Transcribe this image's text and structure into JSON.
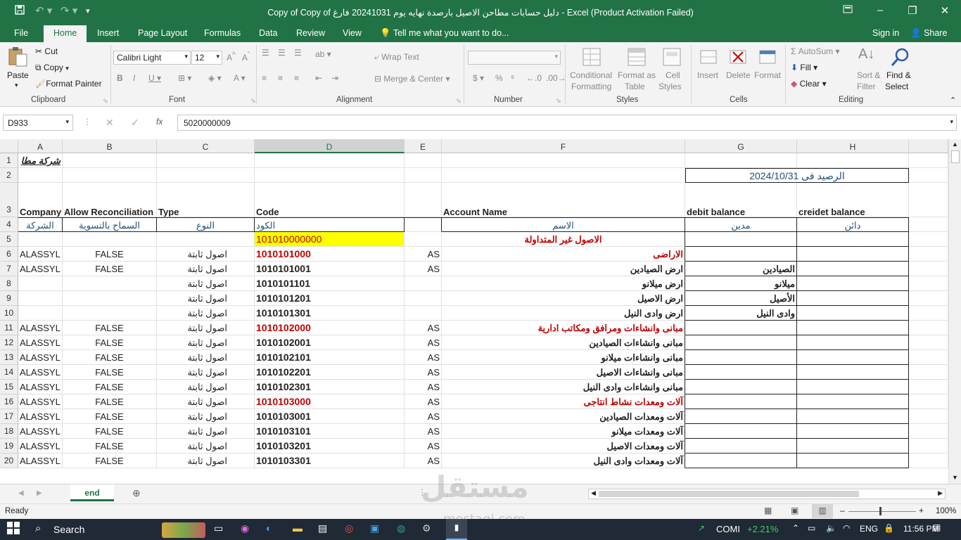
{
  "title_bar": {
    "title": "Copy of Copy of دليل حسابات مطاحن الاصيل بارصدة نهايه يوم 20241031 فارغ - Excel (Product Activation Failed)"
  },
  "menu": {
    "tabs": [
      "File",
      "Home",
      "Insert",
      "Page Layout",
      "Formulas",
      "Data",
      "Review",
      "View"
    ],
    "tell_me": "Tell me what you want to do...",
    "sign_in": "Sign in",
    "share": "Share"
  },
  "ribbon": {
    "clipboard": {
      "paste": "Paste",
      "cut": "Cut",
      "copy": "Copy",
      "format_painter": "Format Painter",
      "label": "Clipboard"
    },
    "font": {
      "name": "Calibri Light",
      "size": "12",
      "label": "Font"
    },
    "alignment": {
      "wrap": "Wrap Text",
      "merge": "Merge & Center",
      "label": "Alignment"
    },
    "number": {
      "label": "Number"
    },
    "styles": {
      "conditional": "Conditional",
      "conditional2": "Formatting",
      "format_as": "Format as",
      "format_as2": "Table",
      "cell": "Cell",
      "cell2": "Styles",
      "label": "Styles"
    },
    "cells": {
      "insert": "Insert",
      "delete": "Delete",
      "format": "Format",
      "label": "Cells"
    },
    "editing": {
      "autosum": "AutoSum",
      "fill": "Fill",
      "clear": "Clear",
      "sort": "Sort &",
      "sort2": "Filter",
      "find": "Find &",
      "find2": "Select",
      "label": "Editing"
    }
  },
  "formula_bar": {
    "name_box": "D933",
    "fx": "fx",
    "value": "5020000009"
  },
  "columns": [
    "A",
    "B",
    "C",
    "D",
    "E",
    "F",
    "G",
    "H"
  ],
  "rows": [
    {
      "n": "1",
      "A": "شركة مطا",
      "B": "",
      "C": "",
      "D": "",
      "E": "",
      "F": "",
      "G": "",
      "H": ""
    },
    {
      "n": "2",
      "A": "",
      "B": "",
      "C": "",
      "D": "",
      "E": "",
      "F": "",
      "G": "الرصيد فى 2024/10/31",
      "H": ""
    },
    {
      "n": "3",
      "A": "Company",
      "B": "Allow Reconciliation",
      "C": "Type",
      "D": "Code",
      "E": "",
      "F": "Account Name",
      "G": "debit balance",
      "H": "creidet balance"
    },
    {
      "n": "4",
      "A": "الشركة",
      "B": "السماح بالتسوية",
      "C": "النوع",
      "D": "الكود",
      "E": "",
      "F": "الاسم",
      "G": "مدين",
      "H": "دائن"
    },
    {
      "n": "5",
      "A": "",
      "B": "",
      "C": "",
      "D": "101010000000",
      "E": "",
      "F": "الاصول غير المتداولة",
      "G": "",
      "H": ""
    },
    {
      "n": "6",
      "A": "ALASSYL",
      "B": "FALSE",
      "C": "اصول ثابتة",
      "D": "1010101000",
      "E": "AS",
      "F": "الاراضى",
      "G": "",
      "H": ""
    },
    {
      "n": "7",
      "A": "ALASSYL",
      "B": "FALSE",
      "C": "اصول ثابتة",
      "D": "1010101001",
      "E": "AS",
      "F": "ارض الصيادين",
      "G": "الصيادين",
      "H": ""
    },
    {
      "n": "8",
      "A": "",
      "B": "",
      "C": "اصول ثابتة",
      "D": "1010101101",
      "E": "",
      "F": "ارض ميلانو",
      "G": "ميلانو",
      "H": ""
    },
    {
      "n": "9",
      "A": "",
      "B": "",
      "C": "اصول ثابتة",
      "D": "1010101201",
      "E": "",
      "F": "ارض الاصيل",
      "G": "الأصيل",
      "H": ""
    },
    {
      "n": "10",
      "A": "",
      "B": "",
      "C": "اصول ثابتة",
      "D": "1010101301",
      "E": "",
      "F": "ارض وادى النيل",
      "G": "وادى النيل",
      "H": ""
    },
    {
      "n": "11",
      "A": "ALASSYL",
      "B": "FALSE",
      "C": "اصول ثابتة",
      "D": "1010102000",
      "E": "AS",
      "F": "مبانى وانشاءات ومرافق ومكاتب ادارية",
      "G": "",
      "H": ""
    },
    {
      "n": "12",
      "A": "ALASSYL",
      "B": "FALSE",
      "C": "اصول ثابتة",
      "D": "1010102001",
      "E": "AS",
      "F": "مبانى وانشاءات الصيادين",
      "G": "",
      "H": ""
    },
    {
      "n": "13",
      "A": "ALASSYL",
      "B": "FALSE",
      "C": "اصول ثابتة",
      "D": "1010102101",
      "E": "AS",
      "F": "مبانى وانشاءات ميلانو",
      "G": "",
      "H": ""
    },
    {
      "n": "14",
      "A": "ALASSYL",
      "B": "FALSE",
      "C": "اصول ثابتة",
      "D": "1010102201",
      "E": "AS",
      "F": "مبانى وانشاءات الاصيل",
      "G": "",
      "H": ""
    },
    {
      "n": "15",
      "A": "ALASSYL",
      "B": "FALSE",
      "C": "اصول ثابتة",
      "D": "1010102301",
      "E": "AS",
      "F": "مبانى وانشاءات وادى النيل",
      "G": "",
      "H": ""
    },
    {
      "n": "16",
      "A": "ALASSYL",
      "B": "FALSE",
      "C": "اصول ثابتة",
      "D": "1010103000",
      "E": "AS",
      "F": "آلات ومعدات نشاط انتاجى",
      "G": "",
      "H": ""
    },
    {
      "n": "17",
      "A": "ALASSYL",
      "B": "FALSE",
      "C": "اصول ثابتة",
      "D": "1010103001",
      "E": "AS",
      "F": "آلات ومعدات الصيادين",
      "G": "",
      "H": ""
    },
    {
      "n": "18",
      "A": "ALASSYL",
      "B": "FALSE",
      "C": "اصول ثابتة",
      "D": "1010103101",
      "E": "AS",
      "F": "آلات ومعدات ميلانو",
      "G": "",
      "H": ""
    },
    {
      "n": "19",
      "A": "ALASSYL",
      "B": "FALSE",
      "C": "اصول ثابتة",
      "D": "1010103201",
      "E": "AS",
      "F": "آلات ومعدات الاصيل",
      "G": "",
      "H": ""
    },
    {
      "n": "20",
      "A": "ALASSYL",
      "B": "FALSE",
      "C": "اصول ثابتة",
      "D": "1010103301",
      "E": "AS",
      "F": "آلات ومعدات وادى النيل",
      "G": "",
      "H": ""
    }
  ],
  "sheet_tabs": [
    "end"
  ],
  "status": {
    "ready": "Ready",
    "zoom": "100%"
  },
  "taskbar": {
    "search": "Search",
    "ticker": "COMI",
    "ticker_change": "+2.21%",
    "lang": "ENG",
    "time": "11:56 PM"
  },
  "watermark": {
    "main": "مستقل",
    "sub": "mostaql.com"
  },
  "colors": {
    "excel_green": "#217346",
    "red_text": "#c00000",
    "blue_text": "#1f4e79",
    "highlight": "#ffff00"
  }
}
